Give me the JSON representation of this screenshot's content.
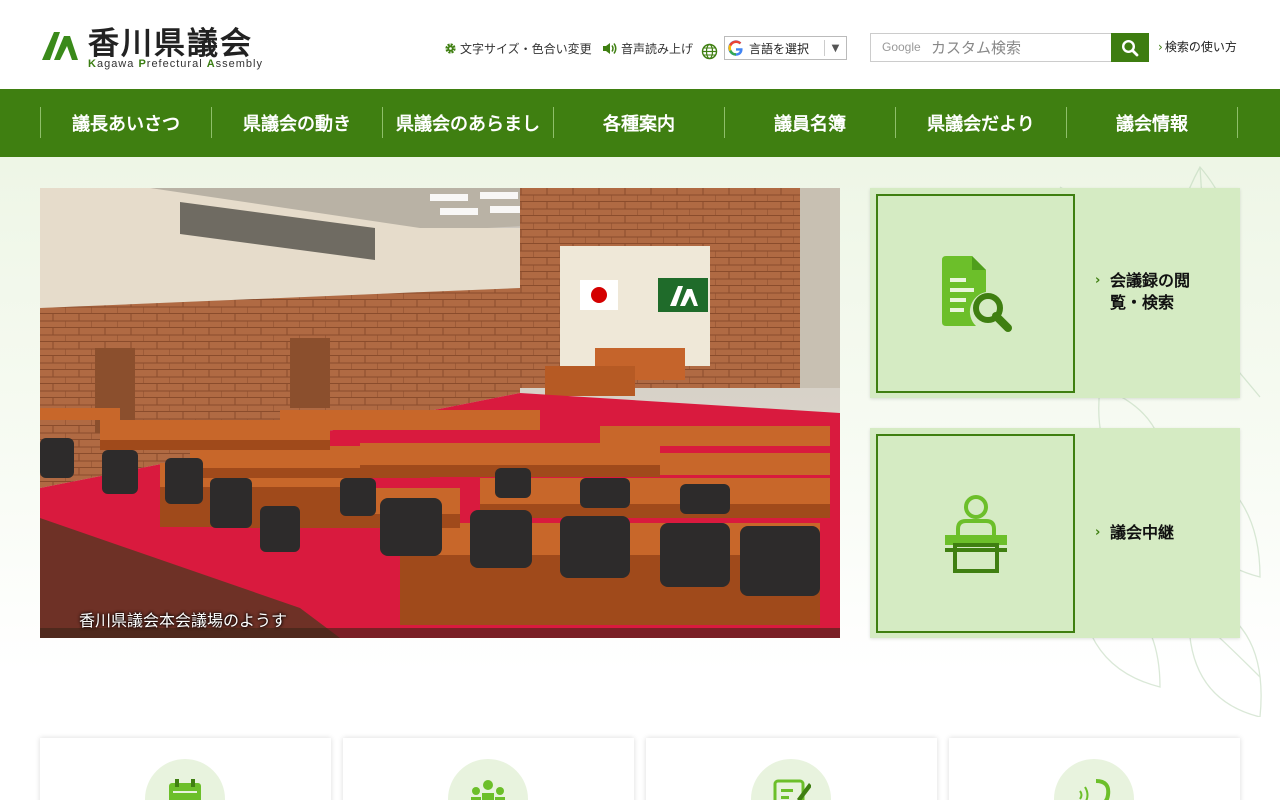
{
  "header": {
    "logo_title": "香川県議会",
    "logo_sub_parts": [
      "K",
      "agawa ",
      "P",
      "refectural ",
      "A",
      "ssembly"
    ],
    "util_fontsize": "文字サイズ・色合い変更",
    "util_speech": "音声読み上げ",
    "lang_label": "言語を選択",
    "lang_arrow": "▼",
    "search_placeholder": "カスタム検索",
    "search_brand": "Google",
    "search_help": "検索の使い方"
  },
  "nav": {
    "items": [
      "議長あいさつ",
      "県議会の動き",
      "県議会のあらまし",
      "各種案内",
      "議員名簿",
      "県議会だより",
      "議会情報"
    ]
  },
  "hero": {
    "caption": "香川県議会本会議場のようす"
  },
  "cards": [
    {
      "label": "会議録の閲覧・検索",
      "icon": "document-search-icon"
    },
    {
      "label": "議会中継",
      "icon": "speaker-podium-icon"
    }
  ],
  "bottom_cards": [
    {
      "icon": "calendar-icon"
    },
    {
      "icon": "people-icon"
    },
    {
      "icon": "edit-document-icon"
    },
    {
      "icon": "ear-icon"
    }
  ],
  "colors": {
    "brand_green": "#3f7f11",
    "card_bg": "#d5ebc3"
  }
}
